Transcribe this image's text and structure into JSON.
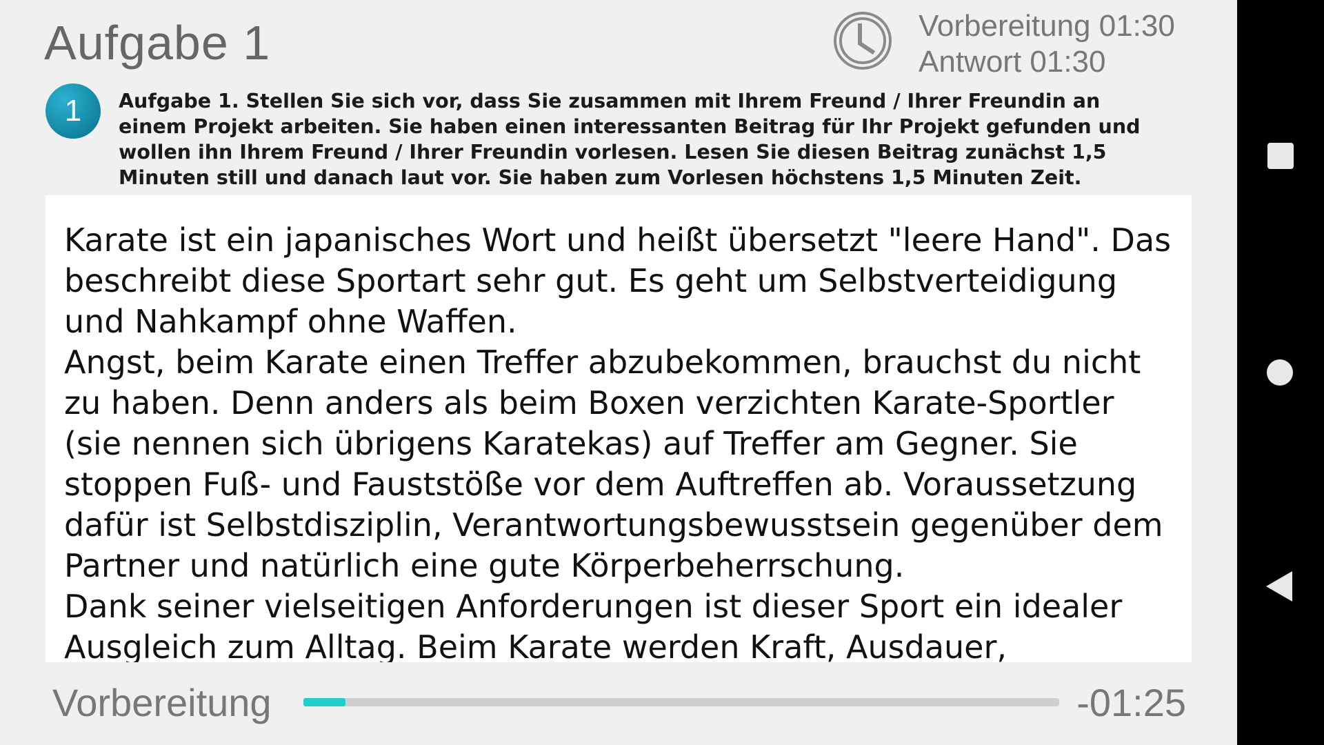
{
  "header": {
    "title": "Aufgabe 1",
    "timer_icon": "clock-icon",
    "preparation_time": "Vorbereitung 01:30",
    "answer_time": "Antwort 01:30"
  },
  "task": {
    "number": "1",
    "instruction": "Aufgabe 1. Stellen Sie sich vor, dass Sie zusammen mit Ihrem Freund / Ihrer Freundin an einem Projekt arbeiten. Sie haben einen interessanten Beitrag für Ihr Projekt gefunden und wollen ihn Ihrem Freund / Ihrer Freundin vorlesen. Lesen Sie diesen Beitrag zunächst 1,5 Minuten still und danach laut vor. Sie haben zum Vorlesen höchstens 1,5 Minuten Zeit."
  },
  "reading": {
    "text": "Karate ist ein japanisches Wort und heißt übersetzt \"leere Hand\". Das beschreibt diese Sportart sehr gut. Es geht um Selbstverteidigung und Nahkampf ohne Waffen.\nAngst, beim Karate einen Treffer abzubekommen, brauchst du nicht zu haben. Denn anders als beim Boxen verzichten Karate-Sportler (sie nennen sich übrigens Karatekas) auf Treffer am Gegner. Sie stoppen Fuß- und Fauststöße vor dem Auftreffen ab. Voraussetzung dafür ist Selbstdisziplin, Verantwortungsbewusstsein gegenüber dem Partner und natürlich eine gute Körperbeherrschung.\nDank seiner vielseitigen Anforderungen ist dieser Sport ein idealer Ausgleich zum Alltag. Beim Karate werden Kraft, Ausdauer,"
  },
  "footer": {
    "phase_label": "Vorbereitung",
    "time_remaining": "-01:25",
    "progress_fraction": 0.0556,
    "progress_color": "#22cfc8"
  },
  "navigation": {
    "recents_icon": "square-icon",
    "home_icon": "circle-icon",
    "back_icon": "triangle-back-icon"
  },
  "colors": {
    "accent": "#1597b5",
    "background": "#f0f0f0",
    "panel": "#ffffff"
  }
}
